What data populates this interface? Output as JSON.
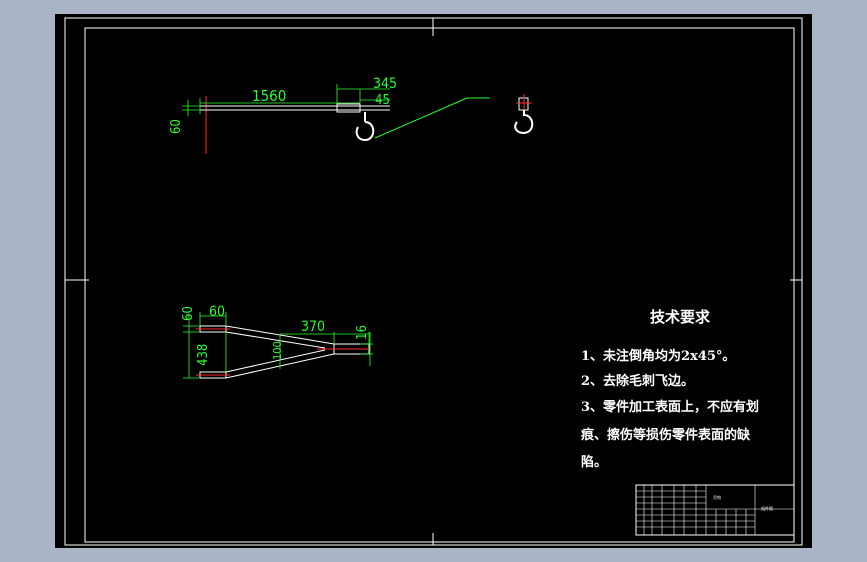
{
  "colors": {
    "background": "#a9b4c6",
    "canvas": "#000000",
    "frame": "#ffffff",
    "dimension": "#27ff27",
    "part": "#ffffff",
    "center_line": "#ff2a2a"
  },
  "top_view": {
    "dim_length": "1560",
    "dim_hook": "345",
    "dim_small": "45",
    "dim_height": "60"
  },
  "bottom_view": {
    "dim_left_top": "60",
    "dim_left_width": "60",
    "dim_taper": "370",
    "dim_right": "16",
    "dim_span": "438",
    "dim_inner": "100"
  },
  "tech_notes": {
    "heading": "技术要求",
    "lines": [
      "1、未注倒角均为2x45°。",
      "2、去除毛刺飞边。",
      "3、零件加工表面上，不应有划",
      "痕、擦伤等损伤零件表面的缺",
      "陷。"
    ]
  },
  "title_block": {
    "part_name": "吊钩",
    "drawing_name": "组件图"
  }
}
